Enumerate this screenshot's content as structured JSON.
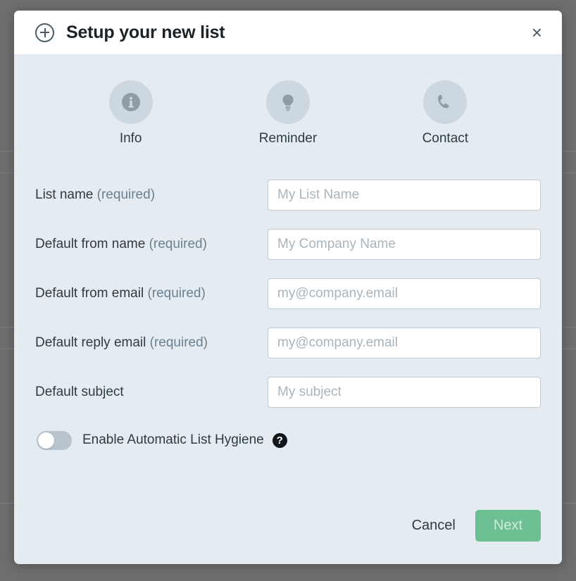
{
  "dialog": {
    "title": "Setup your new list",
    "add_icon": "plus-circle-icon",
    "close_label": "×"
  },
  "tabs": [
    {
      "label": "Info",
      "icon": "info-icon"
    },
    {
      "label": "Reminder",
      "icon": "lightbulb-icon"
    },
    {
      "label": "Contact",
      "icon": "phone-icon"
    }
  ],
  "fields": [
    {
      "label": "List name",
      "required_suffix": " (required)",
      "placeholder": "My List Name",
      "value": ""
    },
    {
      "label": "Default from name",
      "required_suffix": " (required)",
      "placeholder": "My Company Name",
      "value": ""
    },
    {
      "label": "Default from email",
      "required_suffix": " (required)",
      "placeholder": "my@company.email",
      "value": ""
    },
    {
      "label": "Default reply email",
      "required_suffix": " (required)",
      "placeholder": "my@company.email",
      "value": ""
    },
    {
      "label": "Default subject",
      "required_suffix": "",
      "placeholder": "My subject",
      "value": ""
    }
  ],
  "hygiene": {
    "label": "Enable Automatic List Hygiene",
    "toggle_state": "off",
    "help_glyph": "?"
  },
  "footer": {
    "cancel_label": "Cancel",
    "next_label": "Next"
  },
  "colors": {
    "modal_body": "#e4ebf1",
    "header_bg": "#ffffff",
    "overlay": "#6e6e6e",
    "text": "#2d3b45",
    "muted_text": "#6b8090",
    "placeholder": "#a9b4bd",
    "icon_circle": "#ccd7df",
    "icon_glyph": "#8e9ca7",
    "primary_button": "#6cbf93",
    "input_border": "#c3ccd3"
  }
}
